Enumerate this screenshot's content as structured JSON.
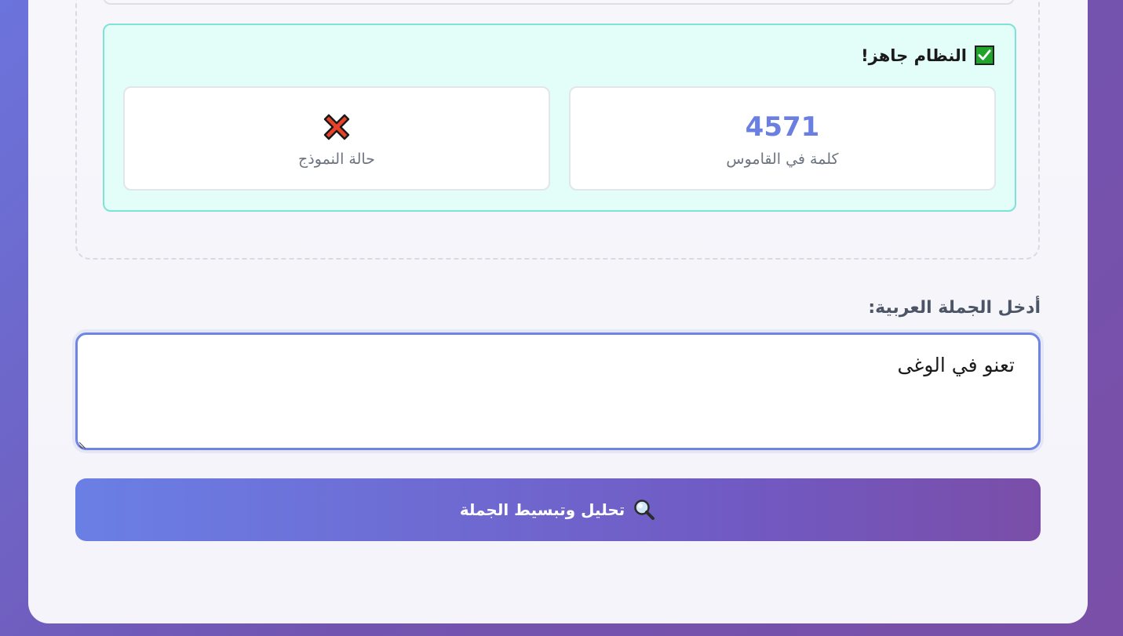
{
  "status": {
    "title": "النظام جاهز!",
    "dictionary_count": "4571",
    "dictionary_label": "كلمة في القاموس",
    "model_label": "حالة النموذج",
    "model_status_icon": "cross-mark-icon"
  },
  "input": {
    "label": "أدخل الجملة العربية:",
    "value": "تعنو في الوغى"
  },
  "action": {
    "button_label": "تحليل وتبسيط الجملة",
    "button_icon": "search-icon"
  },
  "colors": {
    "accent": "#6a7fe0",
    "success_border": "#7fe2d6",
    "success_bg": "#e3fdf8"
  }
}
